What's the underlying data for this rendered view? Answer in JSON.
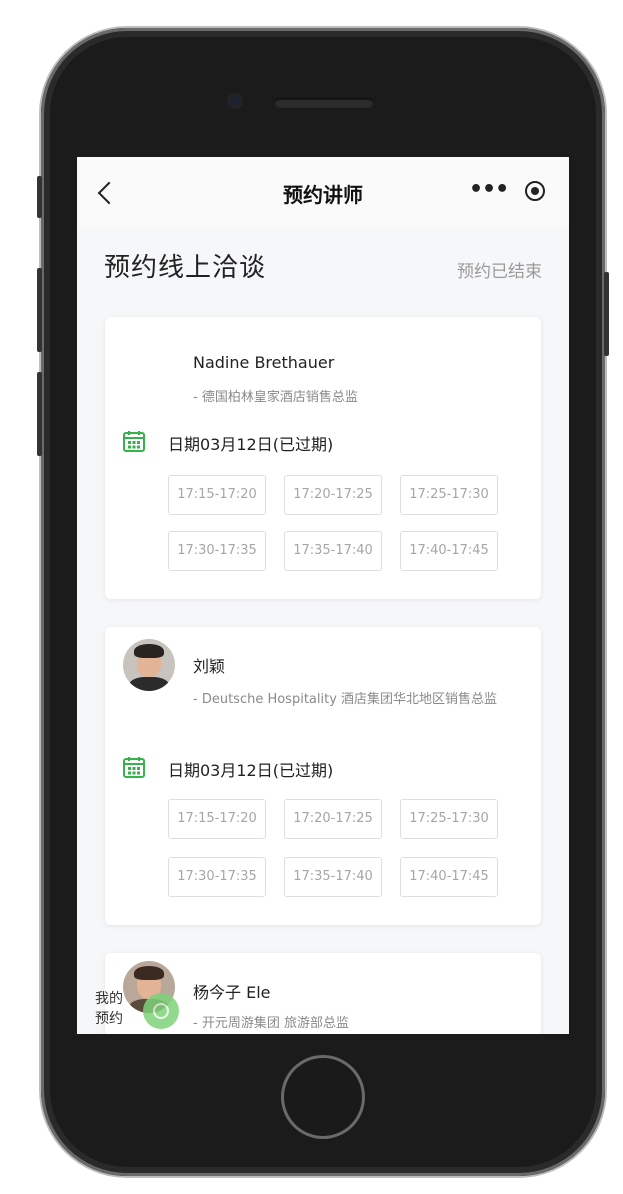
{
  "nav": {
    "title": "预约讲师",
    "more_label": "•••"
  },
  "header": {
    "title": "预约线上洽谈",
    "status": "预约已结束"
  },
  "cards": [
    {
      "name": "Nadine Brethauer",
      "desc": "- 德国柏林皇家酒店销售总监",
      "date": "日期03月12日(已过期)",
      "slots": [
        "17:15-17:20",
        "17:20-17:25",
        "17:25-17:30",
        "17:30-17:35",
        "17:35-17:40",
        "17:40-17:45"
      ]
    },
    {
      "name": "刘颖",
      "desc": "- Deutsche Hospitality 酒店集团华北地区销售总监",
      "date": "日期03月12日(已过期)",
      "slots": [
        "17:15-17:20",
        "17:20-17:25",
        "17:25-17:30",
        "17:30-17:35",
        "17:35-17:40",
        "17:40-17:45"
      ]
    },
    {
      "name": "杨今子 Ele",
      "desc": "- 开元周游集团 旅游部总监"
    }
  ],
  "floating": {
    "label": "我的预约"
  },
  "colors": {
    "accent_green": "#36b24a"
  }
}
